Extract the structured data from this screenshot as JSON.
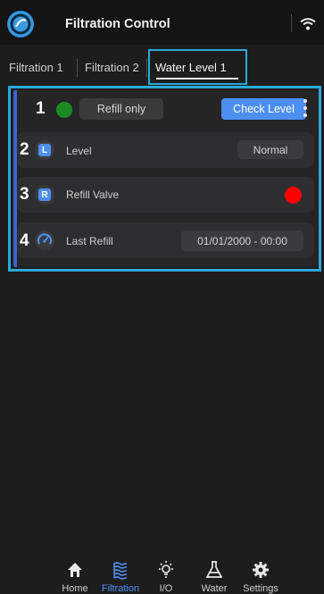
{
  "header": {
    "title": "Filtration Control",
    "logo_icon": "app-logo-icon",
    "wifi_icon": "wifi-icon"
  },
  "tabs": [
    {
      "label": "Filtration 1",
      "active": false
    },
    {
      "label": "Filtration 2",
      "active": false
    },
    {
      "label": "Water Level 1",
      "active": true
    }
  ],
  "card": {
    "markers": [
      "1",
      "2",
      "3",
      "4"
    ],
    "status_color": "#1c8a22",
    "refill_button": "Refill only",
    "check_button": "Check Level",
    "rows": [
      {
        "icon_letter": "L",
        "label": "Level",
        "value": "Normal"
      },
      {
        "icon_letter": "R",
        "label": "Refill Valve",
        "value_color": "#ff0000"
      },
      {
        "icon": "gauge-icon",
        "label": "Last Refill",
        "value": "01/01/2000 - 00:00"
      }
    ]
  },
  "nav": [
    {
      "label": "Home",
      "icon": "home-icon",
      "active": false
    },
    {
      "label": "Filtration",
      "icon": "filtration-icon",
      "active": true
    },
    {
      "label": "I/O",
      "icon": "lightbulb-icon",
      "active": false
    },
    {
      "label": "Water",
      "icon": "flask-icon",
      "active": false
    },
    {
      "label": "Settings",
      "icon": "gear-icon",
      "active": false
    }
  ],
  "colors": {
    "accent": "#4d8ff0",
    "highlight": "#2aa9db",
    "background": "#1d1d1e"
  }
}
